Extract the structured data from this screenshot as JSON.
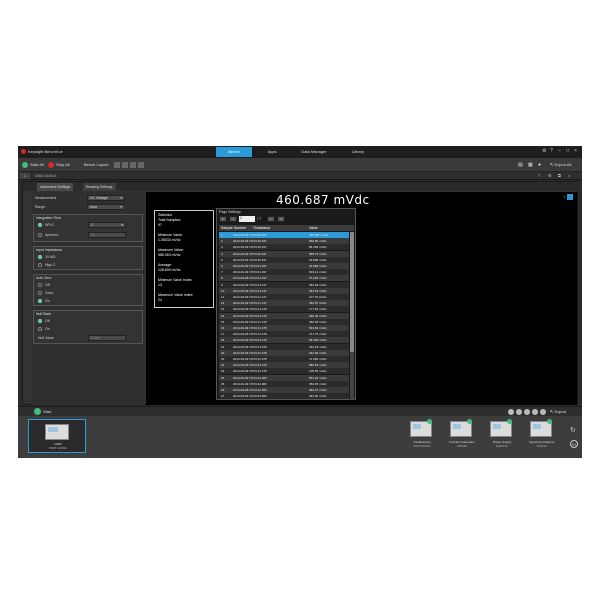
{
  "app": {
    "title": "Keysight BenchVue"
  },
  "main_tabs": [
    {
      "label": "Bench",
      "active": true
    },
    {
      "label": "Apps",
      "active": false
    },
    {
      "label": "Data Manager",
      "active": false
    },
    {
      "label": "Library",
      "active": false
    }
  ],
  "toolbar": {
    "start_all": "Start All",
    "stop_all": "Stop All",
    "bench_layout": "Bench Layout",
    "export_all": "Export All"
  },
  "instrument": {
    "name": "DMM 34465A",
    "tabs": [
      "Instrument Settings",
      "Reading Settings"
    ]
  },
  "settings": {
    "measurement_label": "Measurement",
    "measurement_value": "DC Voltage",
    "range_label": "Range",
    "range_value": "Auto",
    "integration": {
      "title": "Integration Time",
      "nplc_label": "NPLC",
      "nplc_value": "1",
      "aperture_label": "Aperture",
      "aperture_value": "1s"
    },
    "input_impedance": {
      "title": "Input Impedance",
      "options": [
        "10 MΩ",
        "High Z"
      ],
      "selected": 0
    },
    "auto_zero": {
      "title": "Auto Zero",
      "options": [
        "Off",
        "Once",
        "On"
      ],
      "selected": 2
    },
    "null_state": {
      "title": "Null State",
      "options": [
        "Off",
        "On"
      ],
      "selected": 0,
      "null_value_label": "Null Value",
      "null_value": "0 Vdc"
    }
  },
  "display": {
    "reading": "460.687 mVdc"
  },
  "statistics": {
    "title": "Statistics",
    "lines": [
      "Total Samples:",
      "97",
      "",
      "Minimum Value:",
      "1.05033 mVdc",
      "",
      "Maximum Value:",
      "988.363 mVdc",
      "",
      "Average:",
      "128.690 mVdc",
      "",
      "Minimum Value Index:",
      "13",
      "",
      "Maximum Value Index:",
      "24"
    ]
  },
  "paging": {
    "title": "Page Settings",
    "page": "1",
    "page_of": "/ 7",
    "columns": [
      "Sample Number",
      "Timestamp",
      "Value"
    ],
    "rows": [
      [
        "1",
        "2014-09-09 15:54:40.037",
        "460.687 mVdc"
      ],
      [
        "2",
        "2014-09-09 15:54:40.337",
        "848.65 mVdc"
      ],
      [
        "3",
        "2014-09-09 15:54:40.537",
        "86.465 mVdc"
      ],
      [
        "4",
        "2014-09-09 15:54:40.637",
        "868.79 mVdc"
      ],
      [
        "5",
        "2014-09-09 15:54:40.837",
        "54.868 mVdc"
      ],
      [
        "6",
        "2014-09-09 15:54:41.037",
        "34.808 mVdc"
      ],
      [
        "7",
        "2014-09-09 15:54:41.037",
        "503.14 mVdc"
      ],
      [
        "8",
        "2014-09-09 15:54:41.037",
        "57.292 mVdc"
      ],
      [
        "9",
        "2014-09-09 15:54:41.137",
        "482.69 mVdc"
      ],
      [
        "10",
        "2014-09-09 15:54:41.137",
        "384.59 mVdc"
      ],
      [
        "11",
        "2014-09-09 15:54:41.137",
        "117.79 mVdc"
      ],
      [
        "12",
        "2014-09-09 15:54:41.137",
        "484.97 mVdc"
      ],
      [
        "13",
        "2014-09-09 15:54:41.478",
        "177.69 mVdc"
      ],
      [
        "14",
        "2014-09-09 15:54:41.478",
        "290.36 mVdc"
      ],
      [
        "15",
        "2014-09-09 15:54:41.478",
        "466.65 mVdc"
      ],
      [
        "16",
        "2014-09-09 15:54:41.478",
        "563.84 mVdc"
      ],
      [
        "17",
        "2014-09-09 15:54:41.478",
        "717.79 mVdc"
      ],
      [
        "18",
        "2014-09-09 15:54:41.478",
        "58.365 mVdc"
      ],
      [
        "19",
        "2014-09-09 15:54:41.678",
        "322.18 mVdc"
      ],
      [
        "20",
        "2014-09-09 15:54:41.678",
        "463.99 mVdc"
      ],
      [
        "21",
        "2014-09-09 15:54:42.078",
        "71.384 mVdc"
      ],
      [
        "22",
        "2014-09-09 15:54:42.278",
        "686.69 mVdc"
      ],
      [
        "23",
        "2014-09-09 15:54:42.278",
        "108.55 mVdc"
      ],
      [
        "24",
        "2014-09-09 15:54:42.383",
        "563.26 mVdc"
      ],
      [
        "25",
        "2014-09-09 15:54:42.383",
        "384.65 mVdc"
      ],
      [
        "26",
        "2014-09-09 15:54:42.383",
        "482.27 mVdc"
      ],
      [
        "27",
        "2014-09-09 15:54:42.383",
        "384.06 mVdc"
      ]
    ]
  },
  "bottom": {
    "start_label": "Start",
    "export_label": "Export"
  },
  "tray": {
    "active": {
      "name": "DMM",
      "model": "DMM 34465A"
    },
    "devices": [
      {
        "name": "Oscilloscope",
        "model": "DSOX2014A"
      },
      {
        "name": "Function Generator",
        "model": "33522B"
      },
      {
        "name": "Power Supply",
        "model": "E36313A"
      },
      {
        "name": "Spectrum Analyzer",
        "model": "N9322C"
      }
    ]
  },
  "colors": {
    "accent": "#2b9ad8",
    "run": "#3fbf7f",
    "stop": "#d9262b"
  }
}
